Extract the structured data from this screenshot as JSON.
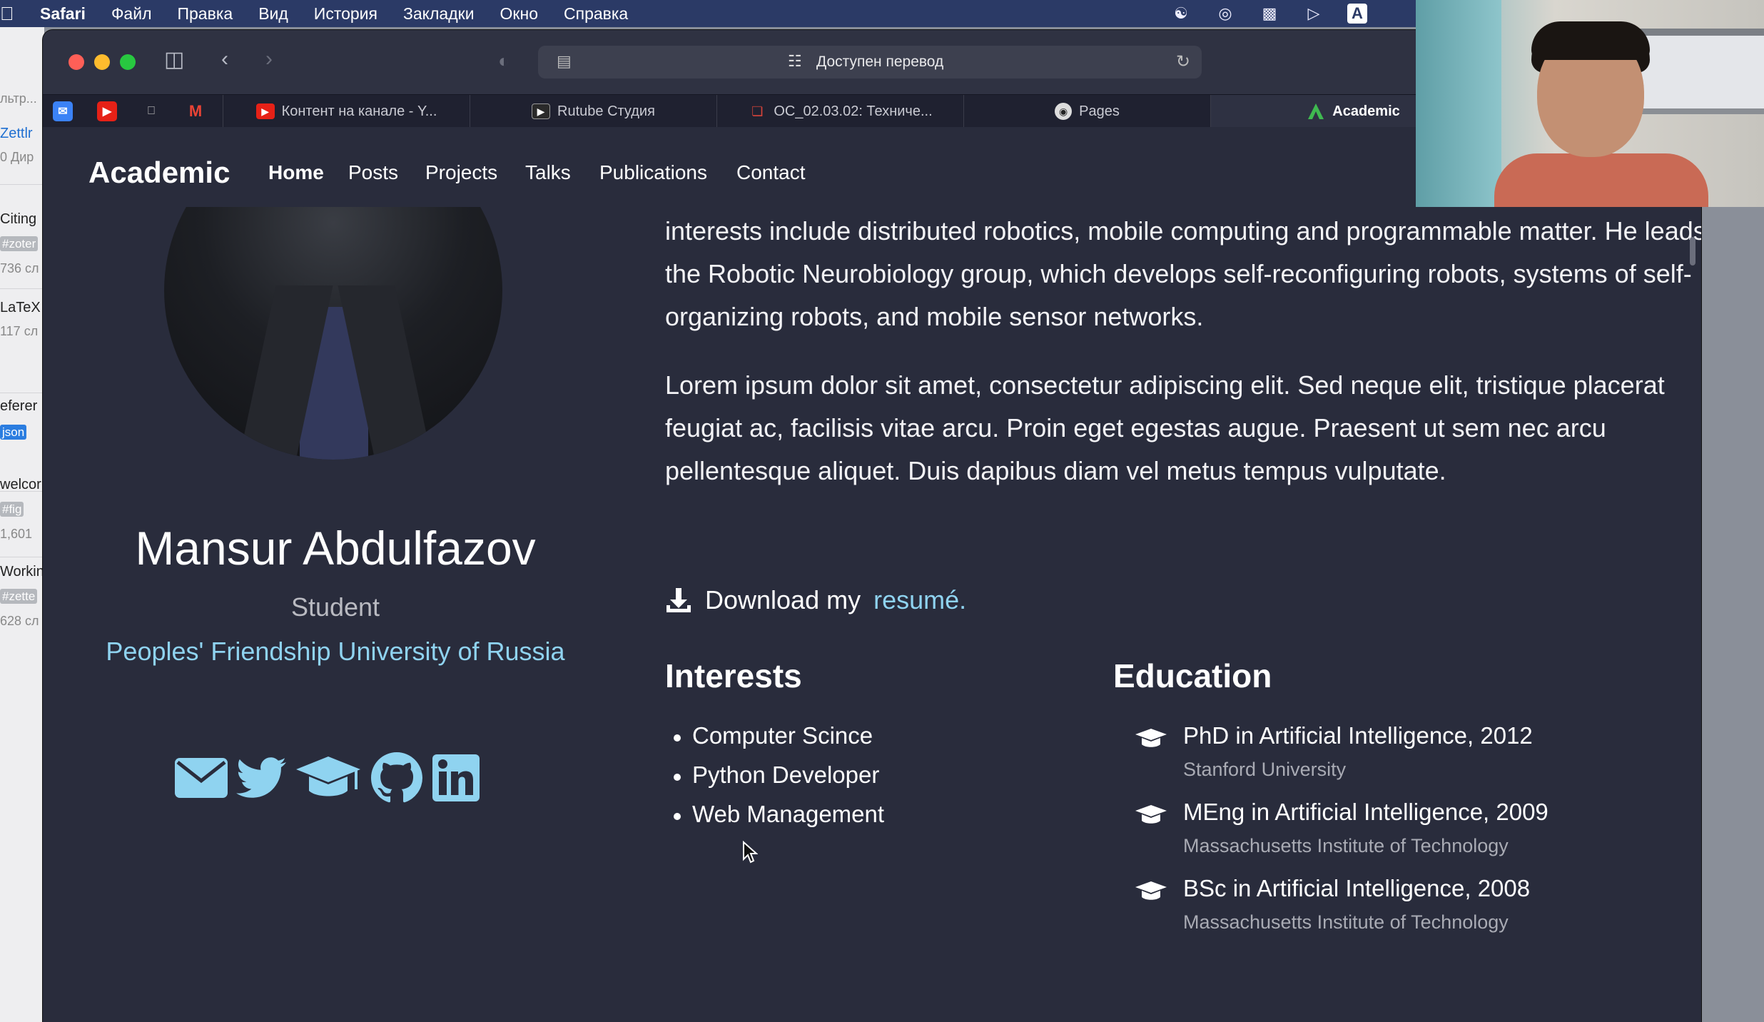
{
  "menubar": {
    "app": "Safari",
    "items": [
      "Файл",
      "Правка",
      "Вид",
      "История",
      "Закладки",
      "Окно",
      "Справка"
    ],
    "status_box_letter": "A"
  },
  "background_app": {
    "rows": [
      "льтр...",
      "Zettlr",
      "0 Дир",
      "Citing",
      "#zoter",
      "736 сл",
      "LaTeX",
      "117 сл",
      "eferer",
      "json",
      "welcor",
      "#fig",
      "1,601",
      "Workin",
      "#zette",
      "628 сл"
    ]
  },
  "browser": {
    "address_text": "Доступен перевод",
    "pinned_tabs": [
      "mail-icon",
      "youtube-icon",
      "apple-icon",
      "gmail-icon"
    ],
    "tabs": [
      {
        "label": "Контент на канале - Y...",
        "icon": "youtube-icon",
        "color": "#e62117"
      },
      {
        "label": "Rutube Студия",
        "icon": "play-icon",
        "color": "#2a2a2a"
      },
      {
        "label": "OC_02.03.02: Техниче...",
        "icon": "doc-icon",
        "color": "#d9443a"
      },
      {
        "label": "Pages",
        "icon": "github-icon",
        "color": "#444"
      },
      {
        "label": "Academic",
        "icon": "academic-icon",
        "color": "#3fb950",
        "active": true
      }
    ]
  },
  "site": {
    "brand": "Academic",
    "nav": [
      "Home",
      "Posts",
      "Projects",
      "Talks",
      "Publications",
      "Contact"
    ],
    "profile": {
      "name": "Mansur Abdulfazov",
      "role": "Student",
      "university": "Peoples' Friendship University of Russia"
    },
    "socials": [
      "envelope-icon",
      "twitter-icon",
      "graduation-cap-icon",
      "github-icon",
      "linkedin-icon"
    ],
    "bio": [
      "Nelson Bighetti is a professor of artificial intelligence at the Stanford AI Lab. His research interests include distributed robotics, mobile computing and programmable matter. He leads the Robotic Neurobiology group, which develops self-reconfiguring robots, systems of self-organizing robots, and mobile sensor networks.",
      "Lorem ipsum dolor sit amet, consectetur adipiscing elit. Sed neque elit, tristique placerat feugiat ac, facilisis vitae arcu. Proin eget egestas augue. Praesent ut sem nec arcu pellentesque aliquet. Duis dapibus diam vel metus tempus vulputate."
    ],
    "download": {
      "prefix": "Download my",
      "link": "resumé",
      "suffix": "."
    },
    "interests_title": "Interests",
    "interests": [
      "Computer Scince",
      "Python Developer",
      "Web Management"
    ],
    "education_title": "Education",
    "education": [
      {
        "degree": "PhD in Artificial Intelligence, 2012",
        "school": "Stanford University"
      },
      {
        "degree": "MEng in Artificial Intelligence, 2009",
        "school": "Massachusetts Institute of Technology"
      },
      {
        "degree": "BSc in Artificial Intelligence, 2008",
        "school": "Massachusetts Institute of Technology"
      }
    ],
    "colors": {
      "background": "#292c3c",
      "link": "#8fd3f0",
      "text": "#ffffff",
      "muted": "#a9abb4"
    }
  }
}
